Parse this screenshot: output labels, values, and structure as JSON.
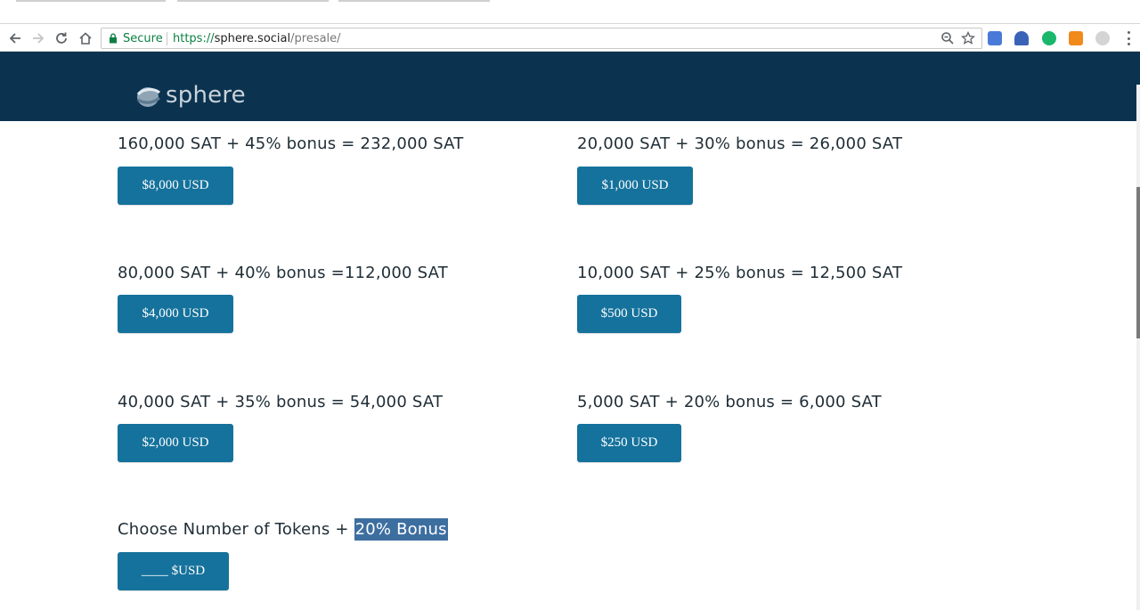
{
  "browser": {
    "secure_label": "Secure",
    "url_scheme": "https://",
    "url_host": "sphere.social",
    "url_path": "/presale/"
  },
  "site": {
    "logo_text": "sphere",
    "header_color": "#0b3350",
    "button_color": "#15729c"
  },
  "offers": [
    {
      "title": "160,000 SAT + 45% bonus = 232,000 SAT",
      "button": "$8,000 USD"
    },
    {
      "title": "20,000 SAT + 30% bonus = 26,000 SAT",
      "button": "$1,000 USD"
    },
    {
      "title": "80,000 SAT + 40% bonus =112,000 SAT",
      "button": "$4,000 USD"
    },
    {
      "title": "10,000 SAT + 25% bonus = 12,500 SAT",
      "button": "$500 USD"
    },
    {
      "title": "40,000 SAT + 35% bonus = 54,000 SAT",
      "button": "$2,000 USD"
    },
    {
      "title": "5,000 SAT + 20% bonus = 6,000 SAT",
      "button": "$250 USD"
    }
  ],
  "custom": {
    "title_prefix": "Choose Number of Tokens +",
    "title_highlight": "20% Bonus",
    "button": "____ $USD"
  }
}
